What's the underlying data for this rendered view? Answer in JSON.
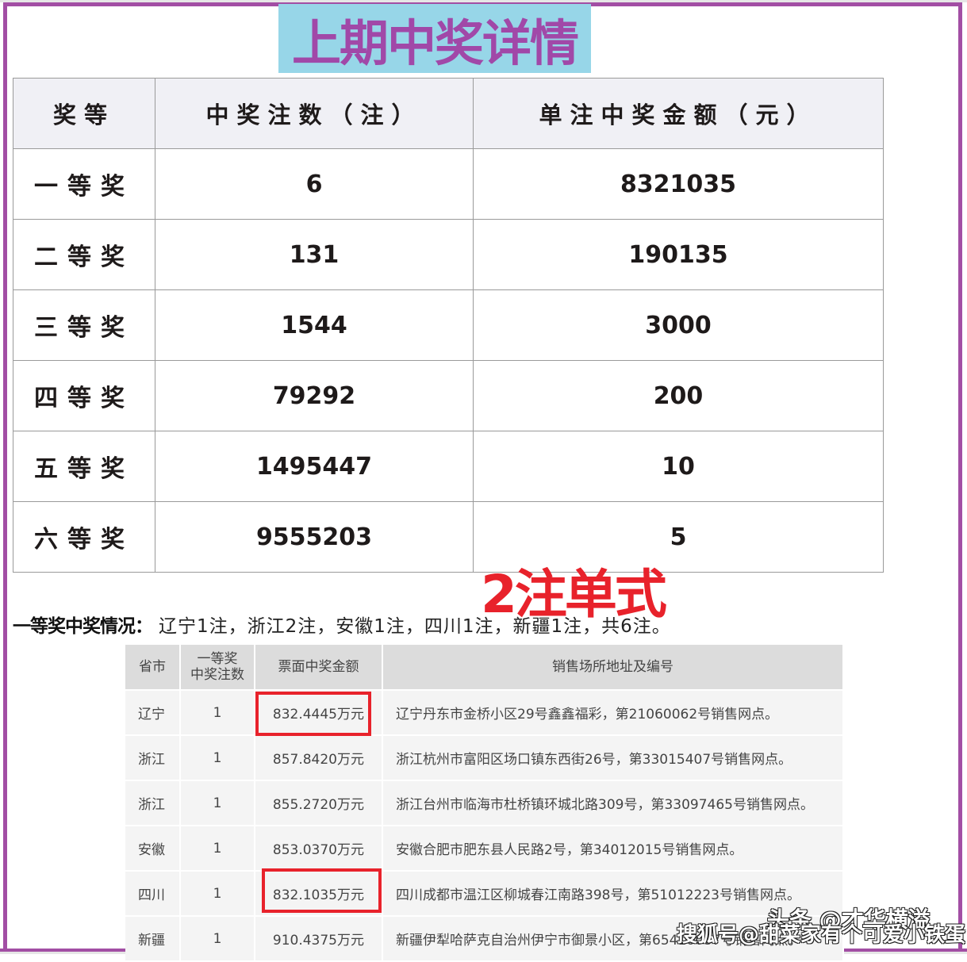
{
  "title": "上期中奖详情",
  "prize_table": {
    "headers": [
      "奖等",
      "中奖注数（注）",
      "单注中奖金额（元）"
    ],
    "rows": [
      {
        "level": "一等奖",
        "count": "6",
        "amount": "8321035"
      },
      {
        "level": "二等奖",
        "count": "131",
        "amount": "190135"
      },
      {
        "level": "三等奖",
        "count": "1544",
        "amount": "3000"
      },
      {
        "level": "四等奖",
        "count": "79292",
        "amount": "200"
      },
      {
        "level": "五等奖",
        "count": "1495447",
        "amount": "10"
      },
      {
        "level": "六等奖",
        "count": "9555203",
        "amount": "5"
      }
    ]
  },
  "annotation": "2注单式",
  "summary": {
    "label": "一等奖中奖情况：",
    "text": "辽宁1注，浙江2注，安徽1注，四川1注，新疆1注，共6注。"
  },
  "detail_table": {
    "headers": [
      "省市",
      "一等奖",
      "中奖注数",
      "票面中奖金额",
      "销售场所地址及编号"
    ],
    "rows": [
      {
        "province": "辽宁",
        "count": "1",
        "amount": "832.4445万元",
        "address": "辽宁丹东市金桥小区29号鑫鑫福彩，第21060062号销售网点。",
        "highlighted": true
      },
      {
        "province": "浙江",
        "count": "1",
        "amount": "857.8420万元",
        "address": "浙江杭州市富阳区场口镇东西街26号，第33015407号销售网点。",
        "highlighted": false
      },
      {
        "province": "浙江",
        "count": "1",
        "amount": "855.2720万元",
        "address": "浙江台州市临海市杜桥镇环城北路309号，第33097465号销售网点。",
        "highlighted": false
      },
      {
        "province": "安徽",
        "count": "1",
        "amount": "853.0370万元",
        "address": "安徽合肥市肥东县人民路2号，第34012015号销售网点。",
        "highlighted": false
      },
      {
        "province": "四川",
        "count": "1",
        "amount": "832.1035万元",
        "address": "四川成都市温江区柳城春江南路398号，第51012223号销售网点。",
        "highlighted": true
      },
      {
        "province": "新疆",
        "count": "1",
        "amount": "910.4375万元",
        "address": "新疆伊犁哈萨克自治州伊宁市御景小区，第65410087号销售网点。",
        "highlighted": false
      }
    ]
  },
  "watermarks": [
    "头条 @才华横溢",
    "搜狐号@甜菜家有个可爱小铁蛋"
  ],
  "colors": {
    "frame": "#a24ea4",
    "title_bg": "#97d6e8",
    "title_text": "#a148a8",
    "highlight_red": "#e8222b"
  }
}
